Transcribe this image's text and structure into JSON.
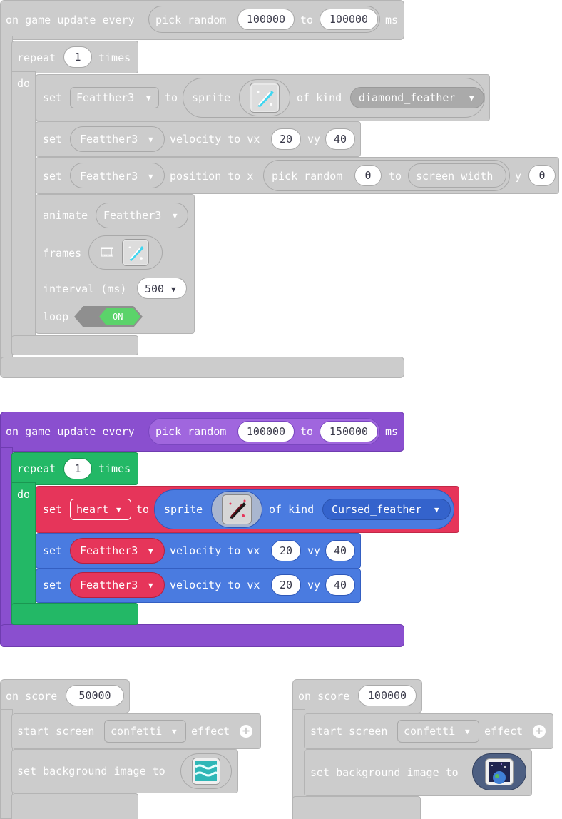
{
  "colors": {
    "disabled_block": "#cccccc",
    "purple_event": "#8a4fcf",
    "green_loop": "#23b866",
    "red_sprite": "#e6355a",
    "blue_motion": "#4a7be0",
    "toggle_on": "#5bd36a"
  },
  "block1": {
    "event_label": "on game update every",
    "pick_random": "pick random",
    "min": "100000",
    "to": "to",
    "max": "100000",
    "ms": "ms",
    "repeat": "repeat",
    "repeat_count": "1",
    "times": "times",
    "do": "do",
    "set1": {
      "set": "set",
      "var": "Featther3",
      "to": "to",
      "sprite": "sprite",
      "image_icon": "diamond-feather-icon",
      "of_kind": "of kind",
      "kind": "diamond_feather"
    },
    "set2": {
      "set": "set",
      "var": "Featther3",
      "velocity": "velocity to vx",
      "vx": "20",
      "vy_label": "vy",
      "vy": "40"
    },
    "set3": {
      "set": "set",
      "var": "Featther3",
      "position": "position to x",
      "pick_random": "pick random",
      "from": "0",
      "to": "to",
      "screen_width": "screen width",
      "y_label": "y",
      "y": "0"
    },
    "animate": {
      "animate": "animate",
      "var": "Featther3",
      "frames": "frames",
      "film_icon": "film-icon",
      "frames_icon": "diamond-feather-icon",
      "interval": "interval (ms)",
      "interval_value": "500",
      "loop": "loop",
      "loop_state": "ON"
    }
  },
  "block2": {
    "event_label": "on game update every",
    "pick_random": "pick random",
    "min": "100000",
    "to": "to",
    "max": "150000",
    "ms": "ms",
    "repeat": "repeat",
    "repeat_count": "1",
    "times": "times",
    "do": "do",
    "set1": {
      "set": "set",
      "var": "heart",
      "to": "to",
      "sprite": "sprite",
      "image_icon": "cursed-feather-icon",
      "of_kind": "of kind",
      "kind": "Cursed_feather"
    },
    "set2": {
      "set": "set",
      "var": "Featther3",
      "velocity": "velocity to vx",
      "vx": "20",
      "vy_label": "vy",
      "vy": "40"
    },
    "set3": {
      "set": "set",
      "var": "Featther3",
      "velocity": "velocity to vx",
      "vx": "20",
      "vy_label": "vy",
      "vy": "40"
    }
  },
  "block3": {
    "on_score": "on score",
    "score": "50000",
    "start_screen": "start screen",
    "effect_name": "confetti",
    "effect": "effect",
    "set_bg": "set background image to",
    "bg_icon": "ocean-waves-image-icon"
  },
  "block4": {
    "on_score": "on score",
    "score": "100000",
    "start_screen": "start screen",
    "effect_name": "confetti",
    "effect": "effect",
    "set_bg": "set background image to",
    "bg_icon": "space-planet-image-icon"
  }
}
